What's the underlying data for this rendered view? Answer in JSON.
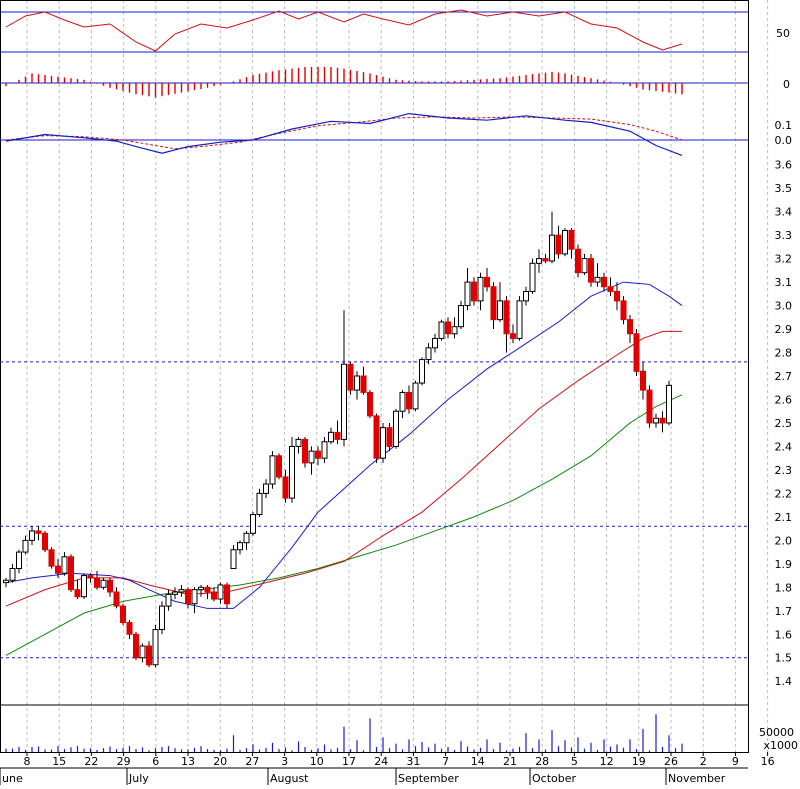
{
  "colors": {
    "up": "#ffffff",
    "down": "#e00000",
    "outline": "#000000",
    "rsi": "#d01010",
    "macd": "#1020c0",
    "signal": "#d01010",
    "hline": "#1a1ad0",
    "ma_fast": "#1a1ad0",
    "ma_mid": "#d01010",
    "ma_slow": "#118811",
    "grid": "#bbbbbb",
    "volume": "#1a1ad0"
  },
  "chart_data": {
    "type": "candlestick",
    "x_day_labels": [
      "8",
      "15",
      "22",
      "29",
      "6",
      "13",
      "20",
      "27",
      "3",
      "10",
      "17",
      "24",
      "31",
      "7",
      "14",
      "21",
      "28",
      "5",
      "12",
      "19",
      "26",
      "2",
      "9",
      "16"
    ],
    "month_labels": [
      "une",
      "July",
      "August",
      "September",
      "October",
      "November"
    ],
    "price_axis": {
      "ylim": [
        1.32,
        3.62
      ],
      "ticks": [
        "1.4",
        "1.5",
        "1.6",
        "1.7",
        "1.8",
        "1.9",
        "2.0",
        "2.1",
        "2.2",
        "2.3",
        "2.4",
        "2.5",
        "2.6",
        "2.7",
        "2.8",
        "2.9",
        "3.0",
        "3.1",
        "3.2",
        "3.3",
        "3.4",
        "3.5",
        "3.6"
      ],
      "ref_lines": [
        1.5,
        2.06,
        2.76
      ]
    },
    "rsi_axis": {
      "label": "50",
      "levels": [
        70,
        30
      ]
    },
    "hist_axis": {
      "label": "0"
    },
    "macd_axis": {
      "labels": [
        "0.1",
        "0.0"
      ]
    },
    "volume_axis": {
      "label": "50000",
      "unit": "x1000"
    },
    "candles": [
      [
        1.82,
        1.84,
        1.8,
        1.83
      ],
      [
        1.83,
        1.9,
        1.82,
        1.88
      ],
      [
        1.88,
        1.96,
        1.86,
        1.95
      ],
      [
        1.95,
        2.02,
        1.94,
        2.0
      ],
      [
        2.0,
        2.06,
        1.98,
        2.04
      ],
      [
        2.04,
        2.06,
        2.0,
        2.03
      ],
      [
        2.03,
        2.04,
        1.95,
        1.96
      ],
      [
        1.96,
        1.97,
        1.88,
        1.89
      ],
      [
        1.89,
        1.92,
        1.84,
        1.86
      ],
      [
        1.86,
        1.95,
        1.85,
        1.93
      ],
      [
        1.93,
        1.94,
        1.78,
        1.79
      ],
      [
        1.79,
        1.83,
        1.75,
        1.76
      ],
      [
        1.76,
        1.86,
        1.75,
        1.85
      ],
      [
        1.85,
        1.86,
        1.82,
        1.84
      ],
      [
        1.84,
        1.87,
        1.79,
        1.8
      ],
      [
        1.8,
        1.84,
        1.79,
        1.83
      ],
      [
        1.83,
        1.84,
        1.76,
        1.78
      ],
      [
        1.78,
        1.8,
        1.71,
        1.72
      ],
      [
        1.72,
        1.73,
        1.64,
        1.65
      ],
      [
        1.65,
        1.66,
        1.58,
        1.6
      ],
      [
        1.6,
        1.61,
        1.49,
        1.5
      ],
      [
        1.5,
        1.56,
        1.48,
        1.55
      ],
      [
        1.55,
        1.57,
        1.46,
        1.47
      ],
      [
        1.47,
        1.64,
        1.46,
        1.62
      ],
      [
        1.62,
        1.74,
        1.6,
        1.72
      ],
      [
        1.72,
        1.79,
        1.7,
        1.77
      ],
      [
        1.77,
        1.8,
        1.75,
        1.78
      ],
      [
        1.78,
        1.81,
        1.76,
        1.79
      ],
      [
        1.79,
        1.8,
        1.71,
        1.73
      ],
      [
        1.73,
        1.8,
        1.69,
        1.79
      ],
      [
        1.79,
        1.81,
        1.76,
        1.8
      ],
      [
        1.8,
        1.81,
        1.75,
        1.78
      ],
      [
        1.78,
        1.8,
        1.74,
        1.75
      ],
      [
        1.75,
        1.82,
        1.73,
        1.81
      ],
      [
        1.81,
        1.82,
        1.71,
        1.73
      ],
      [
        1.88,
        1.98,
        1.89,
        1.96
      ],
      [
        1.96,
        2.0,
        1.94,
        1.99
      ],
      [
        1.99,
        2.04,
        1.96,
        2.03
      ],
      [
        2.03,
        2.12,
        2.02,
        2.11
      ],
      [
        2.11,
        2.22,
        2.1,
        2.2
      ],
      [
        2.2,
        2.26,
        2.18,
        2.24
      ],
      [
        2.24,
        2.38,
        2.22,
        2.36
      ],
      [
        2.36,
        2.37,
        2.26,
        2.27
      ],
      [
        2.27,
        2.3,
        2.16,
        2.18
      ],
      [
        2.18,
        2.44,
        2.16,
        2.4
      ],
      [
        2.4,
        2.44,
        2.37,
        2.43
      ],
      [
        2.43,
        2.44,
        2.31,
        2.33
      ],
      [
        2.33,
        2.4,
        2.28,
        2.38
      ],
      [
        2.38,
        2.4,
        2.32,
        2.35
      ],
      [
        2.35,
        2.44,
        2.33,
        2.42
      ],
      [
        2.42,
        2.48,
        2.41,
        2.46
      ],
      [
        2.46,
        2.51,
        2.41,
        2.43
      ],
      [
        2.43,
        2.98,
        2.4,
        2.75
      ],
      [
        2.75,
        2.76,
        2.62,
        2.64
      ],
      [
        2.64,
        2.72,
        2.6,
        2.7
      ],
      [
        2.7,
        2.74,
        2.62,
        2.63
      ],
      [
        2.63,
        2.64,
        2.52,
        2.53
      ],
      [
        2.53,
        2.54,
        2.33,
        2.35
      ],
      [
        2.35,
        2.5,
        2.33,
        2.48
      ],
      [
        2.48,
        2.5,
        2.38,
        2.4
      ],
      [
        2.4,
        2.56,
        2.39,
        2.55
      ],
      [
        2.55,
        2.64,
        2.52,
        2.63
      ],
      [
        2.63,
        2.66,
        2.54,
        2.56
      ],
      [
        2.56,
        2.68,
        2.55,
        2.67
      ],
      [
        2.67,
        2.78,
        2.66,
        2.77
      ],
      [
        2.77,
        2.84,
        2.75,
        2.82
      ],
      [
        2.82,
        2.88,
        2.8,
        2.86
      ],
      [
        2.86,
        2.94,
        2.85,
        2.93
      ],
      [
        2.93,
        2.95,
        2.86,
        2.88
      ],
      [
        2.88,
        2.95,
        2.86,
        2.91
      ],
      [
        2.91,
        3.02,
        2.9,
        3.0
      ],
      [
        3.0,
        3.16,
        2.98,
        3.1
      ],
      [
        3.1,
        3.12,
        3.0,
        3.02
      ],
      [
        3.02,
        3.14,
        2.98,
        3.12
      ],
      [
        3.12,
        3.16,
        3.06,
        3.08
      ],
      [
        3.08,
        3.1,
        2.9,
        2.94
      ],
      [
        2.94,
        3.1,
        2.93,
        3.02
      ],
      [
        3.02,
        3.04,
        2.8,
        2.88
      ],
      [
        2.88,
        2.92,
        2.84,
        2.86
      ],
      [
        2.86,
        3.04,
        2.85,
        3.02
      ],
      [
        3.02,
        3.08,
        3.0,
        3.06
      ],
      [
        3.06,
        3.2,
        3.05,
        3.18
      ],
      [
        3.18,
        3.24,
        3.14,
        3.2
      ],
      [
        3.2,
        3.22,
        3.18,
        3.19
      ],
      [
        3.19,
        3.4,
        3.18,
        3.3
      ],
      [
        3.3,
        3.34,
        3.2,
        3.22
      ],
      [
        3.22,
        3.33,
        3.21,
        3.32
      ],
      [
        3.32,
        3.33,
        3.2,
        3.24
      ],
      [
        3.24,
        3.26,
        3.12,
        3.14
      ],
      [
        3.14,
        3.22,
        3.13,
        3.2
      ],
      [
        3.2,
        3.22,
        3.08,
        3.1
      ],
      [
        3.1,
        3.18,
        3.08,
        3.12
      ],
      [
        3.12,
        3.14,
        3.06,
        3.08
      ],
      [
        3.08,
        3.12,
        3.04,
        3.06
      ],
      [
        3.06,
        3.1,
        2.98,
        3.02
      ],
      [
        3.02,
        3.04,
        2.92,
        2.94
      ],
      [
        2.94,
        2.96,
        2.84,
        2.88
      ],
      [
        2.88,
        2.9,
        2.7,
        2.72
      ],
      [
        2.72,
        2.76,
        2.6,
        2.64
      ],
      [
        2.64,
        2.66,
        2.48,
        2.5
      ],
      [
        2.5,
        2.54,
        2.48,
        2.52
      ],
      [
        2.52,
        2.55,
        2.46,
        2.5
      ],
      [
        2.5,
        2.68,
        2.49,
        2.66
      ]
    ],
    "ma_fast": [
      [
        0,
        1.82
      ],
      [
        4,
        1.84
      ],
      [
        10,
        1.86
      ],
      [
        16,
        1.85
      ],
      [
        19,
        1.83
      ],
      [
        22,
        1.79
      ],
      [
        26,
        1.74
      ],
      [
        31,
        1.71
      ],
      [
        35,
        1.71
      ],
      [
        39,
        1.8
      ],
      [
        44,
        1.97
      ],
      [
        48,
        2.12
      ],
      [
        52,
        2.22
      ],
      [
        56,
        2.32
      ],
      [
        62,
        2.45
      ],
      [
        68,
        2.6
      ],
      [
        74,
        2.73
      ],
      [
        79,
        2.82
      ],
      [
        85,
        2.93
      ],
      [
        90,
        3.04
      ],
      [
        95,
        3.1
      ],
      [
        99,
        3.09
      ],
      [
        102,
        3.04
      ],
      [
        104,
        3.0
      ]
    ],
    "ma_mid": [
      [
        0,
        1.72
      ],
      [
        6,
        1.79
      ],
      [
        12,
        1.84
      ],
      [
        18,
        1.84
      ],
      [
        22,
        1.81
      ],
      [
        28,
        1.77
      ],
      [
        34,
        1.78
      ],
      [
        40,
        1.82
      ],
      [
        46,
        1.86
      ],
      [
        52,
        1.91
      ],
      [
        58,
        2.02
      ],
      [
        64,
        2.12
      ],
      [
        70,
        2.26
      ],
      [
        76,
        2.41
      ],
      [
        82,
        2.56
      ],
      [
        88,
        2.68
      ],
      [
        94,
        2.79
      ],
      [
        98,
        2.86
      ],
      [
        101,
        2.89
      ],
      [
        104,
        2.89
      ]
    ],
    "ma_slow": [
      [
        0,
        1.51
      ],
      [
        6,
        1.6
      ],
      [
        12,
        1.69
      ],
      [
        18,
        1.74
      ],
      [
        24,
        1.77
      ],
      [
        30,
        1.79
      ],
      [
        36,
        1.81
      ],
      [
        42,
        1.84
      ],
      [
        48,
        1.88
      ],
      [
        54,
        1.93
      ],
      [
        60,
        1.98
      ],
      [
        66,
        2.04
      ],
      [
        72,
        2.1
      ],
      [
        78,
        2.17
      ],
      [
        84,
        2.26
      ],
      [
        90,
        2.36
      ],
      [
        96,
        2.5
      ],
      [
        100,
        2.57
      ],
      [
        104,
        2.62
      ]
    ],
    "rsi": [
      [
        0,
        55
      ],
      [
        3,
        66
      ],
      [
        6,
        70
      ],
      [
        9,
        62
      ],
      [
        12,
        55
      ],
      [
        16,
        58
      ],
      [
        20,
        40
      ],
      [
        23,
        31
      ],
      [
        26,
        48
      ],
      [
        30,
        58
      ],
      [
        34,
        54
      ],
      [
        38,
        62
      ],
      [
        42,
        71
      ],
      [
        45,
        63
      ],
      [
        48,
        70
      ],
      [
        52,
        60
      ],
      [
        55,
        68
      ],
      [
        58,
        63
      ],
      [
        62,
        57
      ],
      [
        66,
        68
      ],
      [
        70,
        72
      ],
      [
        74,
        66
      ],
      [
        78,
        70
      ],
      [
        82,
        66
      ],
      [
        86,
        70
      ],
      [
        90,
        58
      ],
      [
        94,
        54
      ],
      [
        98,
        40
      ],
      [
        101,
        32
      ],
      [
        104,
        38
      ]
    ],
    "macd_hist": [
      [
        0,
        -2
      ],
      [
        4,
        6
      ],
      [
        8,
        4
      ],
      [
        12,
        2
      ],
      [
        16,
        -3
      ],
      [
        20,
        -7
      ],
      [
        23,
        -9
      ],
      [
        27,
        -6
      ],
      [
        31,
        -3
      ],
      [
        35,
        1
      ],
      [
        38,
        5
      ],
      [
        42,
        8
      ],
      [
        46,
        10
      ],
      [
        50,
        10
      ],
      [
        52,
        9
      ],
      [
        56,
        6
      ],
      [
        60,
        2
      ],
      [
        64,
        1
      ],
      [
        68,
        1
      ],
      [
        72,
        2
      ],
      [
        76,
        3
      ],
      [
        80,
        5
      ],
      [
        84,
        7
      ],
      [
        86,
        6
      ],
      [
        90,
        3
      ],
      [
        94,
        0
      ],
      [
        98,
        -4
      ],
      [
        102,
        -6
      ],
      [
        104,
        -7
      ]
    ],
    "macd": [
      [
        0,
        -0.01
      ],
      [
        6,
        0.05
      ],
      [
        12,
        0.02
      ],
      [
        17,
        -0.01
      ],
      [
        20,
        -0.06
      ],
      [
        24,
        -0.12
      ],
      [
        28,
        -0.06
      ],
      [
        33,
        -0.02
      ],
      [
        38,
        0.0
      ],
      [
        44,
        0.1
      ],
      [
        50,
        0.17
      ],
      [
        56,
        0.15
      ],
      [
        62,
        0.24
      ],
      [
        68,
        0.2
      ],
      [
        74,
        0.18
      ],
      [
        80,
        0.22
      ],
      [
        86,
        0.18
      ],
      [
        90,
        0.16
      ],
      [
        96,
        0.08
      ],
      [
        100,
        -0.05
      ],
      [
        104,
        -0.14
      ]
    ],
    "macd_signal": [
      [
        0,
        0.0
      ],
      [
        6,
        0.04
      ],
      [
        12,
        0.03
      ],
      [
        18,
        0.0
      ],
      [
        22,
        -0.04
      ],
      [
        26,
        -0.08
      ],
      [
        30,
        -0.06
      ],
      [
        36,
        -0.02
      ],
      [
        42,
        0.06
      ],
      [
        48,
        0.13
      ],
      [
        54,
        0.16
      ],
      [
        60,
        0.2
      ],
      [
        66,
        0.21
      ],
      [
        72,
        0.2
      ],
      [
        78,
        0.21
      ],
      [
        84,
        0.2
      ],
      [
        90,
        0.19
      ],
      [
        96,
        0.14
      ],
      [
        100,
        0.08
      ],
      [
        104,
        0.0
      ]
    ],
    "volume": [
      [
        0,
        8
      ],
      [
        4,
        12
      ],
      [
        7,
        6
      ],
      [
        11,
        14
      ],
      [
        13,
        9
      ],
      [
        17,
        7
      ],
      [
        21,
        11
      ],
      [
        23,
        9
      ],
      [
        25,
        14
      ],
      [
        27,
        6
      ],
      [
        29,
        10
      ],
      [
        32,
        5
      ],
      [
        35,
        40
      ],
      [
        38,
        18
      ],
      [
        41,
        22
      ],
      [
        45,
        25
      ],
      [
        49,
        18
      ],
      [
        52,
        60
      ],
      [
        54,
        28
      ],
      [
        56,
        80
      ],
      [
        58,
        35
      ],
      [
        60,
        20
      ],
      [
        62,
        30
      ],
      [
        64,
        24
      ],
      [
        66,
        20
      ],
      [
        70,
        26
      ],
      [
        74,
        30
      ],
      [
        76,
        22
      ],
      [
        80,
        45
      ],
      [
        82,
        30
      ],
      [
        84,
        52
      ],
      [
        86,
        28
      ],
      [
        88,
        35
      ],
      [
        90,
        22
      ],
      [
        92,
        30
      ],
      [
        94,
        18
      ],
      [
        96,
        30
      ],
      [
        98,
        55
      ],
      [
        100,
        90
      ],
      [
        102,
        40
      ],
      [
        104,
        20
      ]
    ]
  }
}
